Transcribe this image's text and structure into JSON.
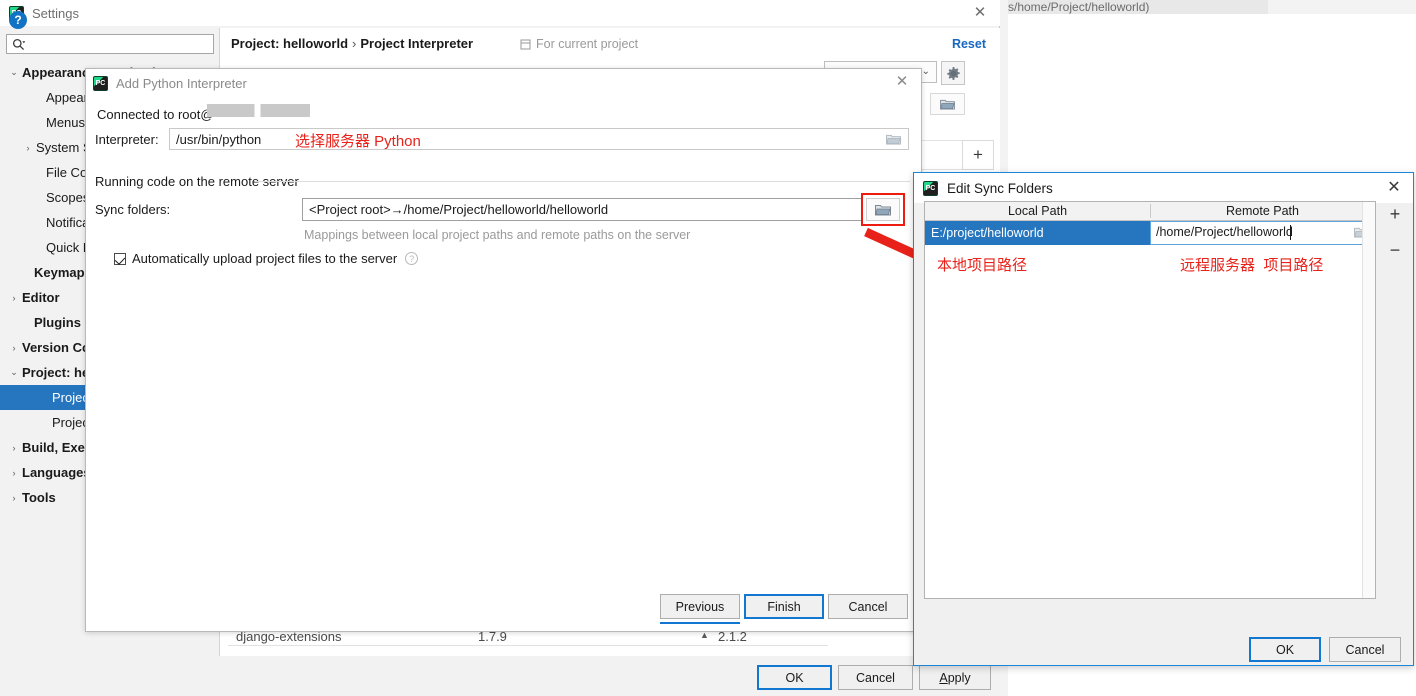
{
  "background": {
    "top_fragment_text": "s/home/Project/helloworld)",
    "package_row": {
      "name": "django-extensions",
      "version": "1.7.9",
      "latest": "2.1.2",
      "update_arrow": "▲"
    }
  },
  "settings_window": {
    "title": "Settings",
    "app_icon": "pycharm-icon",
    "close_icon": "✕",
    "search": {
      "placeholder": "",
      "value": "",
      "icon": "search-icon"
    },
    "sidebar": {
      "items": [
        {
          "label": "Appearance & Behavior",
          "twisty": "⌄",
          "indent": 6,
          "bold": true,
          "selected": false
        },
        {
          "label": "Appearance",
          "twisty": "",
          "indent": 30,
          "bold": false,
          "selected": false
        },
        {
          "label": "Menus and Toolbars",
          "twisty": "",
          "indent": 30,
          "bold": false,
          "selected": false
        },
        {
          "label": "System Settings",
          "twisty": "›",
          "indent": 20,
          "bold": false,
          "selected": false
        },
        {
          "label": "File Colors",
          "twisty": "",
          "indent": 30,
          "bold": false,
          "selected": false
        },
        {
          "label": "Scopes",
          "twisty": "",
          "indent": 30,
          "bold": false,
          "selected": false
        },
        {
          "label": "Notifications",
          "twisty": "",
          "indent": 30,
          "bold": false,
          "selected": false
        },
        {
          "label": "Quick Lists",
          "twisty": "",
          "indent": 30,
          "bold": false,
          "selected": false
        },
        {
          "label": "Keymap",
          "twisty": "",
          "indent": 18,
          "bold": true,
          "selected": false
        },
        {
          "label": "Editor",
          "twisty": "›",
          "indent": 6,
          "bold": true,
          "selected": false
        },
        {
          "label": "Plugins",
          "twisty": "",
          "indent": 18,
          "bold": true,
          "selected": false
        },
        {
          "label": "Version Control",
          "twisty": "›",
          "indent": 6,
          "bold": true,
          "selected": false
        },
        {
          "label": "Project: helloworld",
          "twisty": "⌄",
          "indent": 6,
          "bold": true,
          "selected": false
        },
        {
          "label": "Project Interpreter",
          "twisty": "",
          "indent": 36,
          "bold": false,
          "selected": true
        },
        {
          "label": "Project Structure",
          "twisty": "",
          "indent": 36,
          "bold": false,
          "selected": false
        },
        {
          "label": "Build, Execution, Deployment",
          "twisty": "›",
          "indent": 6,
          "bold": true,
          "selected": false
        },
        {
          "label": "Languages & Frameworks",
          "twisty": "›",
          "indent": 6,
          "bold": true,
          "selected": false
        },
        {
          "label": "Tools",
          "twisty": "›",
          "indent": 6,
          "bold": true,
          "selected": false
        }
      ]
    },
    "pane": {
      "breadcrumb_root": "Project: helloworld",
      "breadcrumb_sep": "›",
      "breadcrumb_leaf": "Project Interpreter",
      "for_current_project": "For current project",
      "for_current_icon": "module-icon",
      "reset_label": "Reset",
      "combo_chevron": "⌄",
      "gear_icon": "gear-icon",
      "folder_icon": "folder-icon",
      "plus_label": "+"
    },
    "footer": {
      "help_icon": "?",
      "ok_label": "OK",
      "cancel_label": "Cancel",
      "apply_label_underlined": "A",
      "apply_label_rest": "pply"
    }
  },
  "add_interpreter_dialog": {
    "title": "Add Python Interpreter",
    "app_icon": "pycharm-icon",
    "close_icon": "✕",
    "connected_label": "Connected to root@",
    "interpreter_label": "Interpreter:",
    "interpreter_value": "/usr/bin/python",
    "interpreter_annotation": "选择服务器 Python",
    "browse_icon": "folder-icon",
    "group_label": "Running code on the remote server",
    "sync_folders_label": "Sync folders:",
    "sync_folders_value": "<Project root>→/home/Project/helloworld/helloworld",
    "sync_browse_icon": "folder-icon",
    "sync_hint": "Mappings between local project paths and remote paths on the server",
    "auto_upload_label": "Automatically upload project files to the server",
    "auto_upload_checked": true,
    "auto_upload_help": "?",
    "previous_label": "Previous",
    "finish_label": "Finish",
    "cancel_label": "Cancel"
  },
  "edit_sync_folders_dialog": {
    "title": "Edit Sync Folders",
    "app_icon": "pycharm-icon",
    "close_icon": "✕",
    "columns": [
      "Local Path",
      "Remote Path"
    ],
    "rows": [
      {
        "local_path": "E:/project/helloworld",
        "remote_path": "/home/Project/helloworld"
      }
    ],
    "remote_folder_icon": "folder-icon",
    "add_label": "+",
    "remove_label": "−",
    "annotation_local": "本地项目路径",
    "annotation_remote_1": "远程服务器",
    "annotation_remote_2": "项目路径",
    "ok_label": "OK",
    "cancel_label": "Cancel"
  },
  "annotations": {
    "highlight_color": "#ee1b11",
    "arrow_color": "#e8221a",
    "selection_color": "#2675bf",
    "link_color": "#1668c2"
  }
}
